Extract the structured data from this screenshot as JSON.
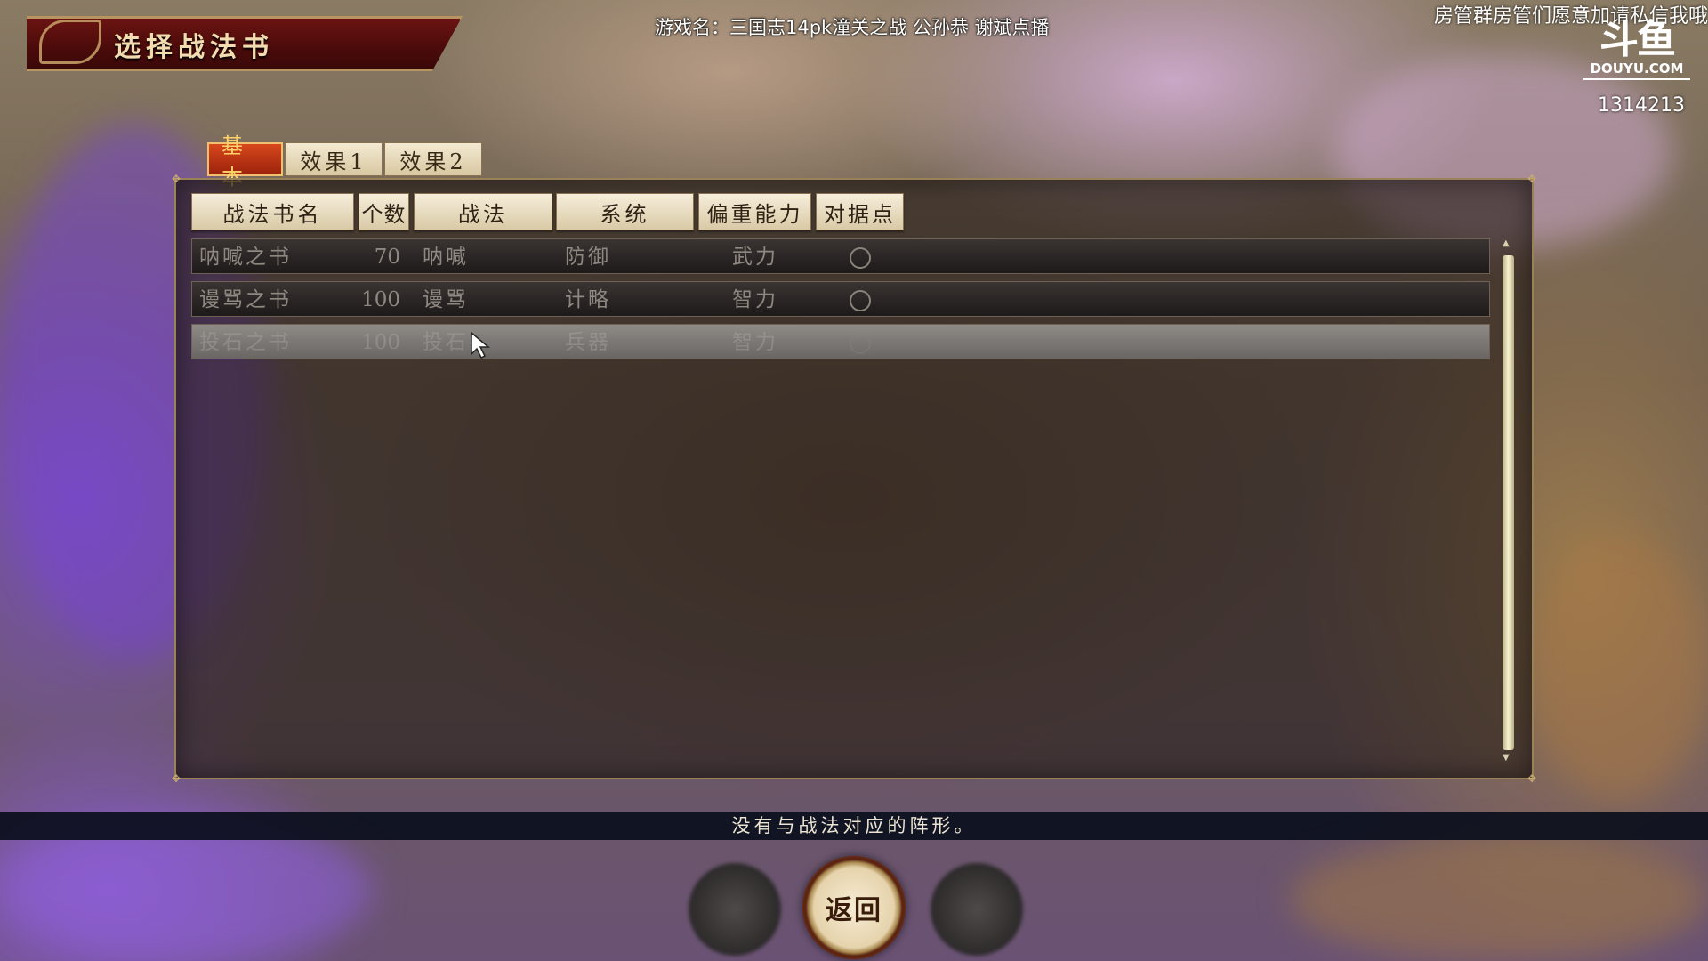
{
  "game_ui": {
    "screen_title": "选择战法书",
    "tabs": [
      {
        "label": "基本",
        "active": true
      },
      {
        "label": "效果1",
        "active": false
      },
      {
        "label": "效果2",
        "active": false
      }
    ],
    "columns": [
      "战法书名",
      "个数",
      "战法",
      "系统",
      "偏重能力",
      "对据点"
    ],
    "rows": [
      {
        "name": "呐喊之书",
        "count": "70",
        "tactic": "呐喊",
        "system": "防御",
        "ability": "武力",
        "vs_base": "○",
        "selected": false
      },
      {
        "name": "谩骂之书",
        "count": "100",
        "tactic": "谩骂",
        "system": "计略",
        "ability": "智力",
        "vs_base": "○",
        "selected": false
      },
      {
        "name": "投石之书",
        "count": "100",
        "tactic": "投石",
        "system": "兵器",
        "ability": "智力",
        "vs_base": "○",
        "selected": true
      }
    ],
    "message": "没有与战法对应的阵形。",
    "return_label": "返回"
  },
  "stream_overlay": {
    "stream_title": "游戏名：三国志14pk潼关之战 公孙恭 谢斌点播",
    "notice": "房管群房管们愿意加请私信我哦",
    "platform_glyph": "斗鱼",
    "platform_name": "DOUYU.COM",
    "room_id": "1314213"
  },
  "colors": {
    "active_tab": "#c23a16",
    "tab_face": "#efe4c8",
    "panel_border": "#9a8258",
    "message_bar": "#0a0e1c"
  }
}
